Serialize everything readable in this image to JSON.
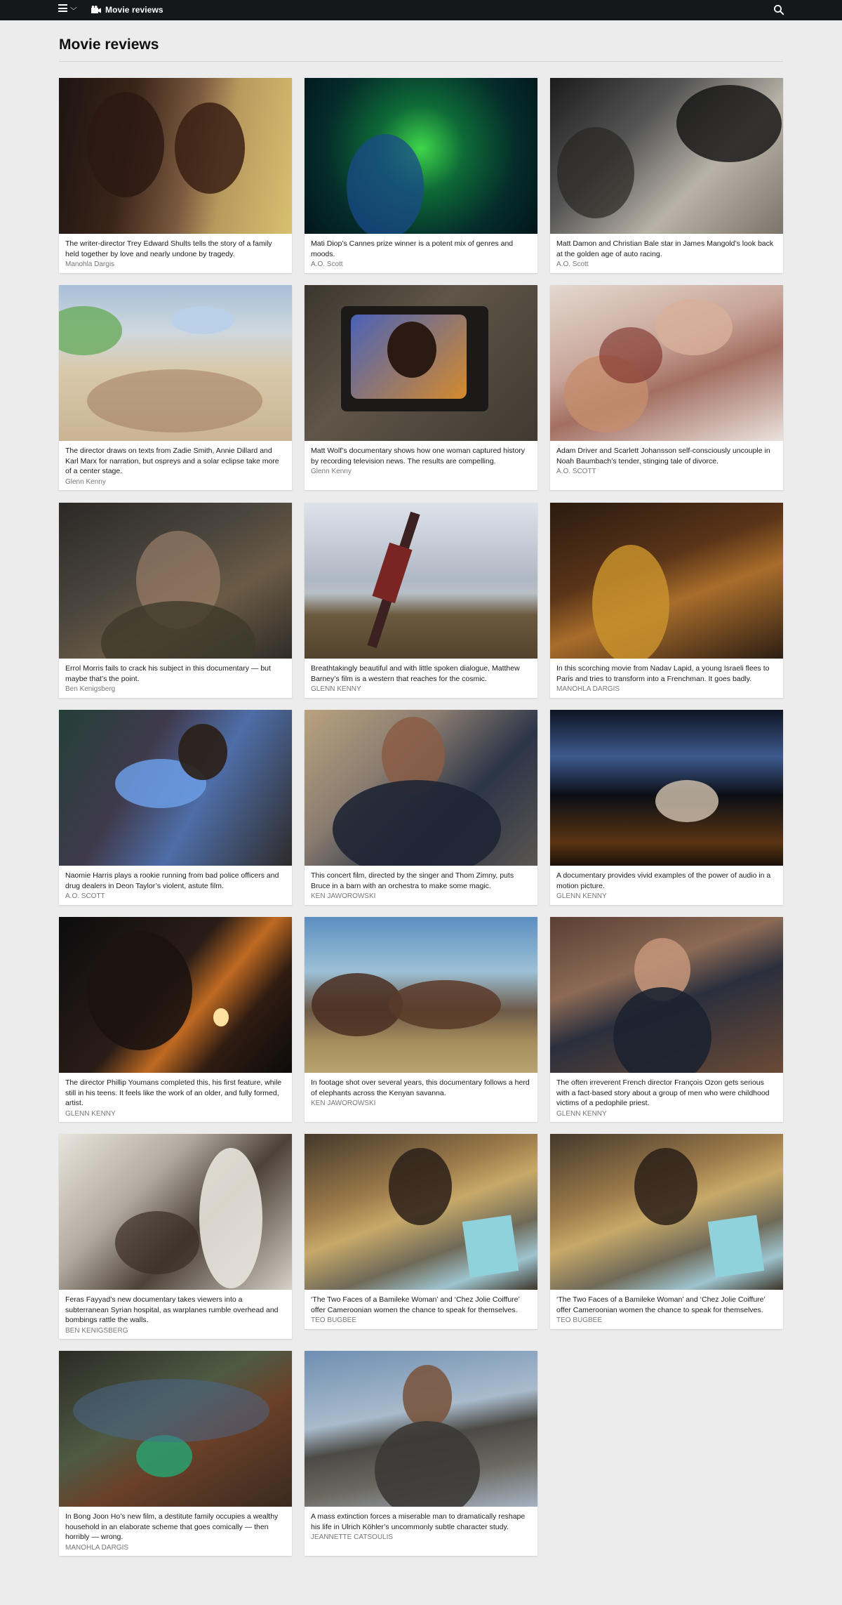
{
  "header": {
    "section_label": "Movie reviews",
    "menu_icon": "hamburger-icon",
    "dropdown_icon": "chevron-down-icon",
    "section_icon": "camera-icon",
    "search_icon": "search-icon",
    "background_color": "#161719"
  },
  "page": {
    "title": "Movie reviews",
    "background_color": "#ececec"
  },
  "reviews": [
    {
      "summary": "The writer-director Trey Edward Shults tells the story of a family held together by love and nearly undone by tragedy.",
      "byline": "Manohla Dargis"
    },
    {
      "summary": "Mati Diop’s Cannes prize winner is a potent mix of genres and moods.",
      "byline": "A.O. Scott"
    },
    {
      "summary": "Matt Damon and Christian Bale star in James Mangold’s look back at the golden age of auto racing.",
      "byline": "A.O. Scott"
    },
    {
      "summary": "The director draws on texts from Zadie Smith, Annie Dillard and Karl Marx for narration, but ospreys and a solar eclipse take more of a center stage.",
      "byline": "Glenn Kenny"
    },
    {
      "summary": "Matt Wolf’s documentary shows how one woman captured history by recording television news. The results are compelling.",
      "byline": "Glenn Kenny"
    },
    {
      "summary": "Adam Driver and Scarlett Johansson self-consciously uncouple in Noah Baumbach’s tender, stinging tale of divorce.",
      "byline": "A.O. SCOTT"
    },
    {
      "summary": "Errol Morris fails to crack his subject in this documentary — but maybe that’s the point.",
      "byline": "Ben Kenigsberg"
    },
    {
      "summary": "Breathtakingly beautiful and with little spoken dialogue, Matthew Barney’s film is a western that reaches for the cosmic.",
      "byline": "GLENN KENNY"
    },
    {
      "summary": "In this scorching movie from Nadav Lapid, a young Israeli flees to Paris and tries to transform into a Frenchman. It goes badly.",
      "byline": "MANOHLA DARGIS"
    },
    {
      "summary": "Naomie Harris plays a rookie running from bad police officers and drug dealers in Deon Taylor’s violent, astute film.",
      "byline": "A.O. SCOTT"
    },
    {
      "summary": "This concert film, directed by the singer and Thom Zimny, puts Bruce in a barn with an orchestra to make some magic.",
      "byline": "KEN JAWOROWSKI"
    },
    {
      "summary": "A documentary provides vivid examples of the power of audio in a motion picture.",
      "byline": "GLENN KENNY"
    },
    {
      "summary": "The director Phillip Youmans completed this, his first feature, while still in his teens. It feels like the work of an older, and fully formed, artist.",
      "byline": "GLENN KENNY"
    },
    {
      "summary": "In footage shot over several years, this documentary follows a herd of elephants across the Kenyan savanna.",
      "byline": "KEN JAWOROWSKI"
    },
    {
      "summary": "The often irreverent French director François Ozon gets serious with a fact-based story about a group of men who were childhood victims of a pedophile priest.",
      "byline": "GLENN KENNY"
    },
    {
      "summary": "Feras Fayyad’s new documentary takes viewers into a subterranean Syrian hospital, as warplanes rumble overhead and bombings rattle the walls.",
      "byline": "BEN KENIGSBERG"
    },
    {
      "summary": "‘The Two Faces of a Bamileke Woman’ and ‘Chez Jolie Coiffure’ offer Cameroonian women the chance to speak for themselves.",
      "byline": "TEO BUGBEE"
    },
    {
      "summary": "‘The Two Faces of a Bamileke Woman’ and ‘Chez Jolie Coiffure’ offer Cameroonian women the chance to speak for themselves.",
      "byline": "TEO BUGBEE"
    },
    {
      "summary": "In Bong Joon Ho’s new film, a destitute family occupies a wealthy household in an elaborate scheme that goes comically — then horribly — wrong.",
      "byline": "MANOHLA DARGIS"
    },
    {
      "summary": "A mass extinction forces a miserable man to dramatically reshape his life in Ulrich Köhler’s uncommonly subtle character study.",
      "byline": "JEANNETTE CATSOULIS"
    }
  ]
}
